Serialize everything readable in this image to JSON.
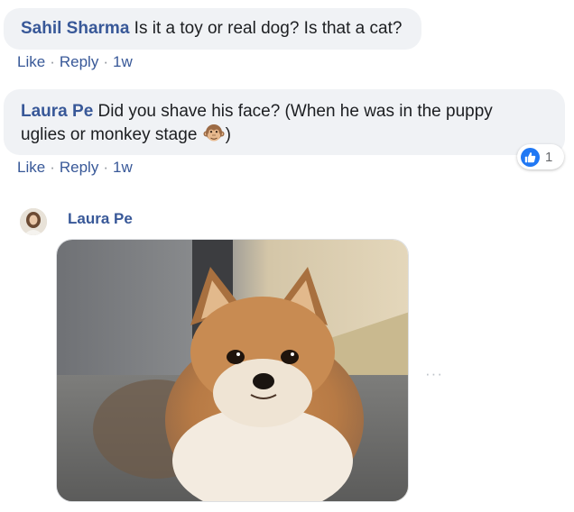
{
  "comments": [
    {
      "author": "Sahil Sharma",
      "text": "Is it a toy or real dog? Is that a cat?",
      "actions": {
        "like": "Like",
        "reply": "Reply",
        "time": "1w"
      }
    },
    {
      "author": "Laura Pe",
      "text_line1": "Did you shave his face? (When he was in the puppy",
      "text_line2_before": "uglies or monkey stage ",
      "text_line2_after": ")",
      "emoji": "monkey-face-icon",
      "reaction": {
        "type": "like-icon",
        "count": "1"
      },
      "actions": {
        "like": "Like",
        "reply": "Reply",
        "time": "1w"
      }
    }
  ],
  "reply": {
    "author": "Laura Pe",
    "attachment": "pomeranian-photo",
    "more_label": "···"
  },
  "colors": {
    "author": "#385898",
    "bubble": "#f0f2f5",
    "like_blue": "#2078f4",
    "meta": "#65676b"
  }
}
